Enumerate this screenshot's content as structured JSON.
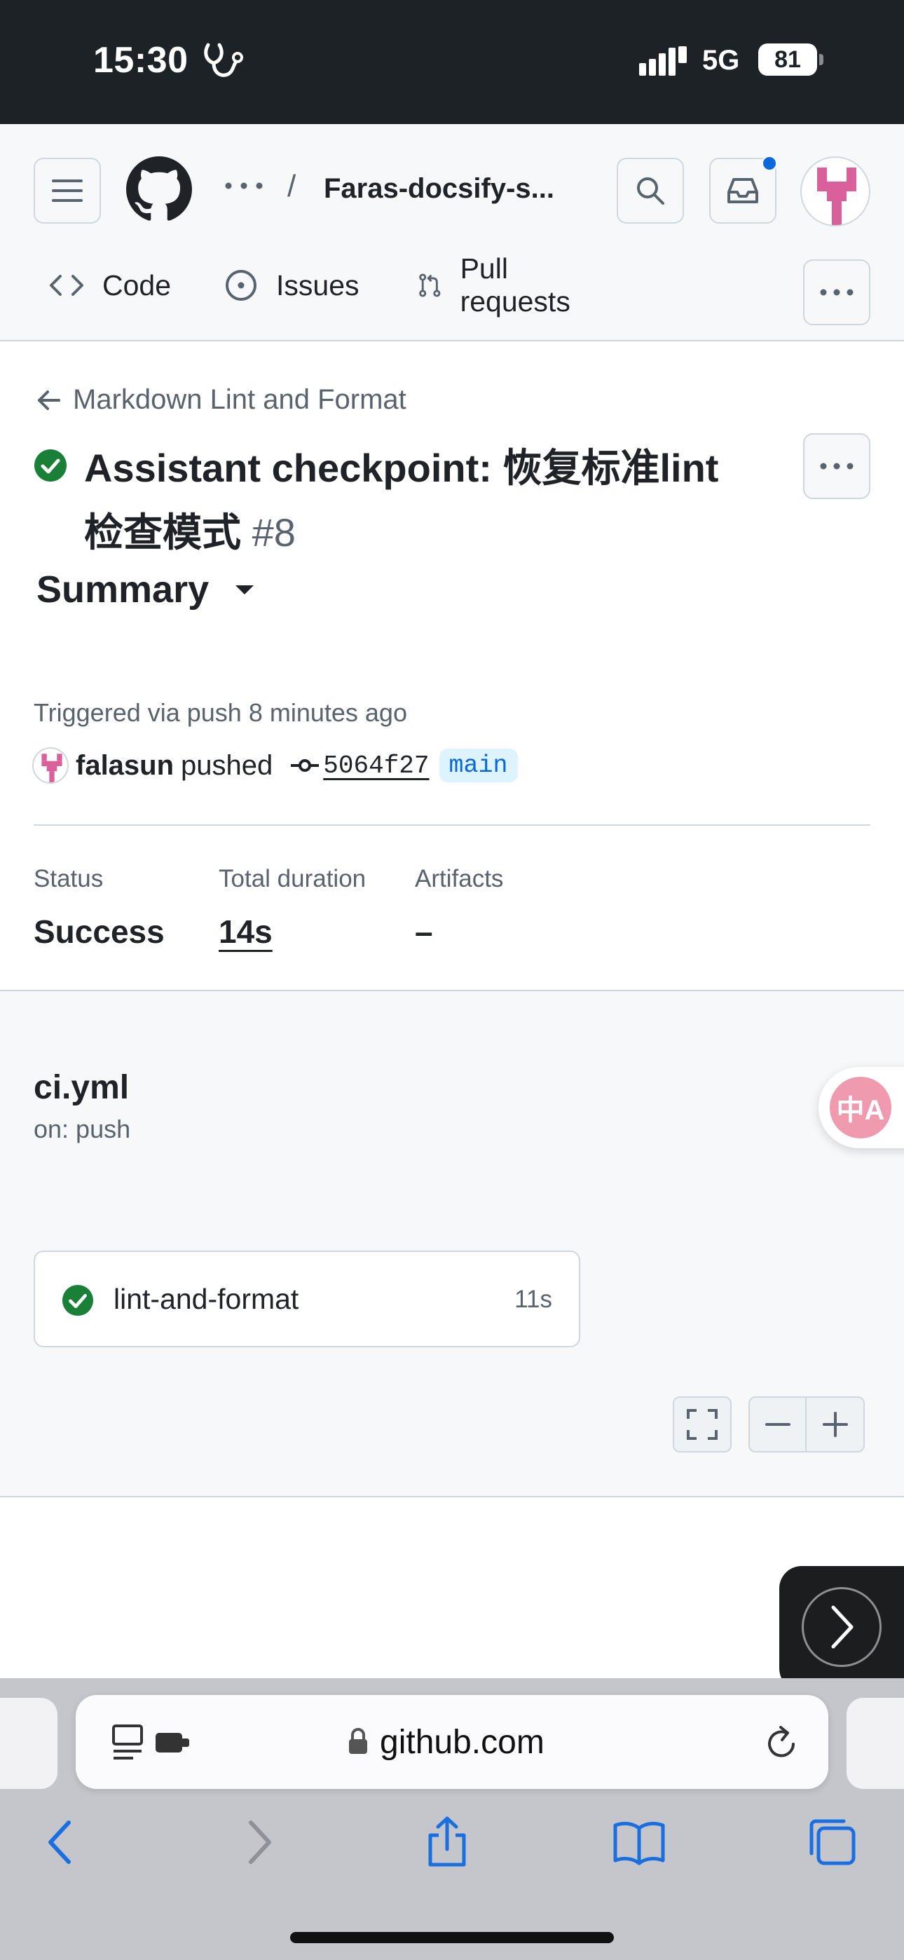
{
  "status_bar": {
    "time": "15:30",
    "network": "5G",
    "battery": "81"
  },
  "header": {
    "repo": "Faras-docsify-s...",
    "separator": "/",
    "tabs": [
      {
        "label": "Code",
        "icon": "code-icon"
      },
      {
        "label": "Issues",
        "icon": "issue-opened-icon"
      },
      {
        "label": "Pull requests",
        "icon": "git-pull-request-icon"
      }
    ]
  },
  "run": {
    "back_label": "Markdown Lint and Format",
    "title": "Assistant checkpoint: 恢复标准lint 检查模式",
    "number": "#8",
    "summary_label": "Summary",
    "triggered": "Triggered via push 8 minutes ago",
    "user": "falasun",
    "action": "pushed",
    "commit": "5064f27",
    "branch": "main",
    "stats": [
      {
        "label": "Status",
        "value": "Success"
      },
      {
        "label": "Total duration",
        "value": "14s"
      },
      {
        "label": "Artifacts",
        "value": "–"
      }
    ]
  },
  "workflow": {
    "file": "ci.yml",
    "trigger": "on: push",
    "job": {
      "name": "lint-and-format",
      "duration": "11s",
      "status": "success"
    }
  },
  "translate_fab": {
    "label": "中A"
  },
  "safari": {
    "url": "github.com"
  },
  "colors": {
    "success": "#1a7f37",
    "accent": "#0969da",
    "header_bg": "#f6f8fa",
    "status_bar_bg": "#1d2226"
  }
}
